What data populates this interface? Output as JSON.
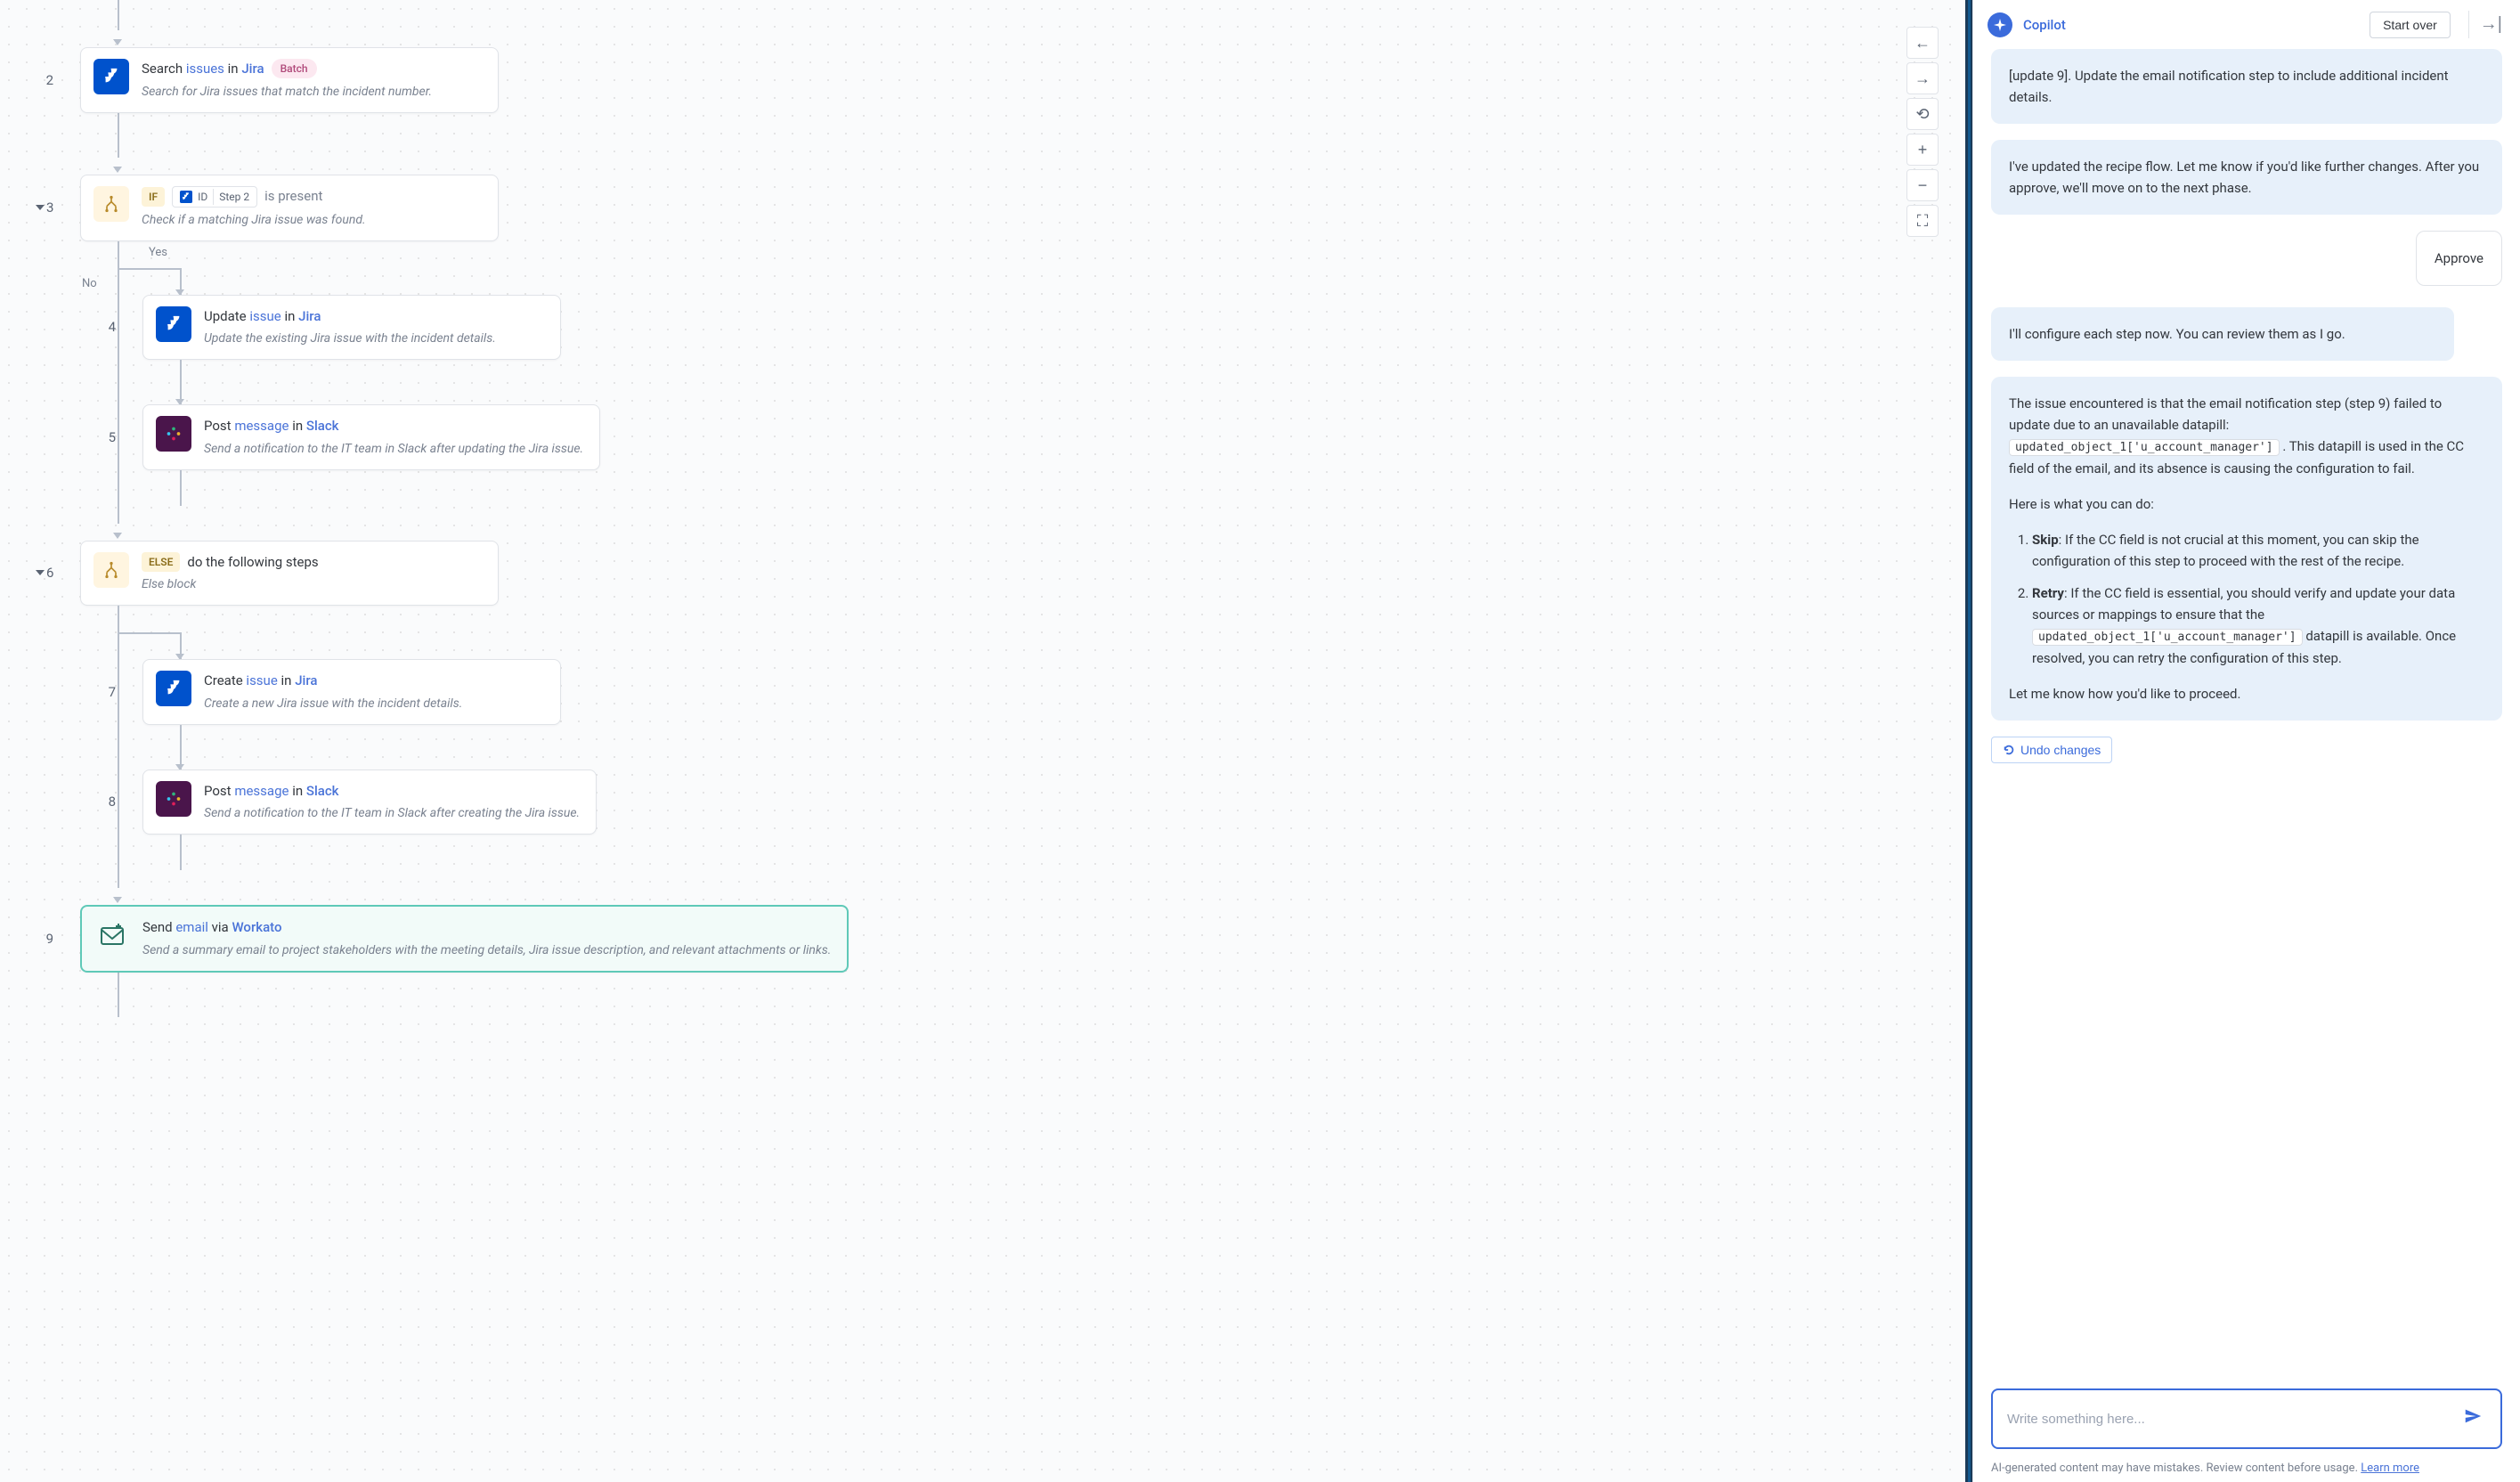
{
  "flow": {
    "step2": {
      "number": "2",
      "title_prefix": "Search",
      "title_obj": "issues",
      "title_in": "in",
      "title_app": "Jira",
      "badge": "Batch",
      "desc": "Search for Jira issues that match the incident number."
    },
    "step3": {
      "number": "3",
      "if_label": "IF",
      "pill_id": "ID",
      "pill_step": "Step 2",
      "present": "is present",
      "desc": "Check if a matching Jira issue was found.",
      "yes_label": "Yes",
      "no_label": "No"
    },
    "step4": {
      "number": "4",
      "title_prefix": "Update",
      "title_obj": "issue",
      "title_in": "in",
      "title_app": "Jira",
      "desc": "Update the existing Jira issue with the incident details."
    },
    "step5": {
      "number": "5",
      "title_prefix": "Post",
      "title_obj": "message",
      "title_in": "in",
      "title_app": "Slack",
      "desc": "Send a notification to the IT team in Slack after updating the Jira issue."
    },
    "step6": {
      "number": "6",
      "else_label": "ELSE",
      "title_rest": "do the following steps",
      "desc": "Else block"
    },
    "step7": {
      "number": "7",
      "title_prefix": "Create",
      "title_obj": "issue",
      "title_in": "in",
      "title_app": "Jira",
      "desc": "Create a new Jira issue with the incident details."
    },
    "step8": {
      "number": "8",
      "title_prefix": "Post",
      "title_obj": "message",
      "title_in": "in",
      "title_app": "Slack",
      "desc": "Send a notification to the IT team in Slack after creating the Jira issue."
    },
    "step9": {
      "number": "9",
      "title_prefix": "Send",
      "title_obj": "email",
      "title_via": "via",
      "title_app": "Workato",
      "desc": "Send a summary email to project stakeholders with the meeting details, Jira issue description, and relevant attachments or links."
    }
  },
  "copilot": {
    "title": "Copilot",
    "start_over": "Start over",
    "msg1": "[update 9]. Update the email notification step to include additional incident details.",
    "msg2": "I've updated the recipe flow. Let me know if you'd like further changes. After you approve, we'll move on to the next phase.",
    "msg3_user": "Approve",
    "msg4": "I'll configure each step now. You can review them as I go.",
    "msg5": {
      "p1a": "The issue encountered is that the email notification step (step 9) failed to update due to an unavailable datapill: ",
      "code1": "updated_object_1['u_account_manager']",
      "p1b": " . This datapill is used in the CC field of the email, and its absence is causing the configuration to fail.",
      "p2": "Here is what you can do:",
      "li1_bold": "Skip",
      "li1": ": If the CC field is not crucial at this moment, you can skip the configuration of this step to proceed with the rest of the recipe.",
      "li2_bold": "Retry",
      "li2a": ": If the CC field is essential, you should verify and update your data sources or mappings to ensure that the ",
      "code2": "updated_object_1['u_account_manager']",
      "li2b": " datapill is available. Once resolved, you can retry the configuration of this step.",
      "p3": "Let me know how you'd like to proceed."
    },
    "undo": "Undo changes",
    "placeholder": "Write something here...",
    "disclaimer_text": "AI-generated content may have mistakes. Review content before usage. ",
    "disclaimer_link": "Learn more"
  }
}
